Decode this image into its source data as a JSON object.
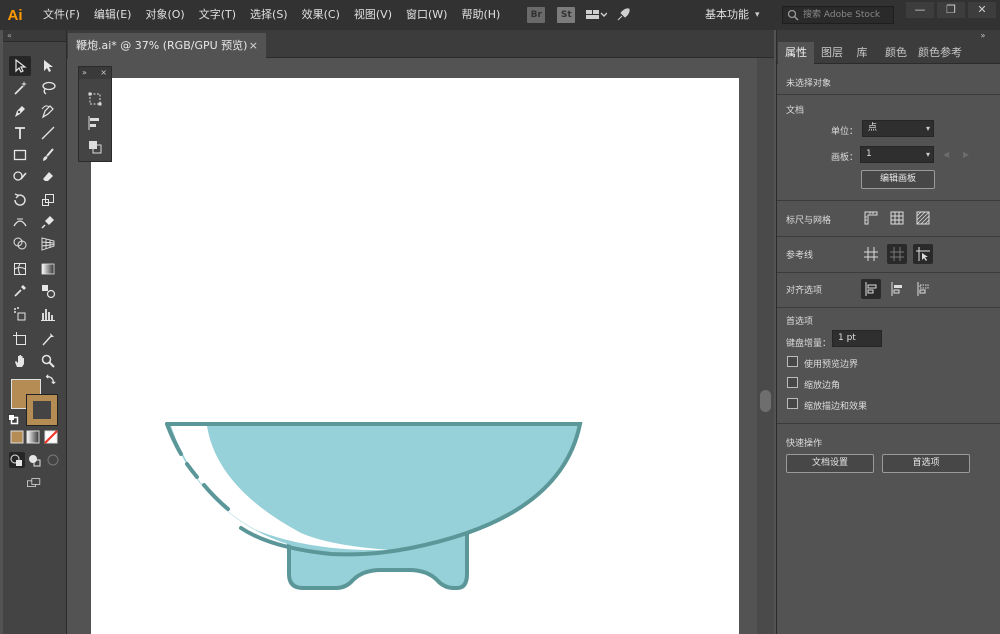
{
  "app": {
    "logo": "Ai",
    "menus": [
      "文件(F)",
      "编辑(E)",
      "对象(O)",
      "文字(T)",
      "选择(S)",
      "效果(C)",
      "视图(V)",
      "窗口(W)",
      "帮助(H)"
    ],
    "bridge_label": "Br",
    "stock_label": "St",
    "workspace": "基本功能",
    "search_placeholder": "搜索 Adobe Stock",
    "window_buttons": [
      "—",
      "❐",
      "✕"
    ]
  },
  "document": {
    "tab_title": "鞭炮.ai* @ 37% (RGB/GPU 预览)",
    "close": "×"
  },
  "colors": {
    "fill": "#b68c55",
    "stroke": "#b68c55",
    "bowl_fill": "#96d0d8",
    "bowl_stroke": "#5b9698",
    "accent_app": "#ff9a00"
  },
  "panel": {
    "tabs": [
      "属性",
      "图层",
      "库",
      "颜色",
      "颜色参考"
    ],
    "no_selection": "未选择对象",
    "document_section": "文档",
    "unit_label": "单位：",
    "unit_value": "点",
    "artboard_label": "画板：",
    "artboard_value": "1",
    "edit_artboard_button": "编辑画板",
    "rulers_grids_label": "标尺与网格",
    "guides_label": "参考线",
    "align_options_label": "对齐选项",
    "preferences_section": "首选项",
    "keyboard_increment_label": "键盘增量：",
    "keyboard_increment_value": "1 pt",
    "checkboxes": [
      "使用预览边界",
      "缩放边角",
      "缩放描边和效果"
    ],
    "quick_actions_section": "快速操作",
    "doc_setup_button": "文档设置",
    "preferences_button": "首选项"
  },
  "icons": {
    "toolbar": [
      "selection-tool-icon",
      "direct-selection-tool-icon",
      "magic-wand-icon",
      "lasso-icon",
      "pen-icon",
      "curvature-icon",
      "type-icon",
      "line-icon",
      "rectangle-icon",
      "paintbrush-icon",
      "shaper-icon",
      "eraser-icon",
      "rotate-icon",
      "scale-icon",
      "width-icon",
      "puppet-warp-icon",
      "shape-builder-icon",
      "perspective-grid-icon",
      "mesh-icon",
      "gradient-icon",
      "eyedropper-icon",
      "blend-icon",
      "symbol-sprayer-icon",
      "column-graph-icon",
      "artboard-icon",
      "slice-icon",
      "hand-icon",
      "zoom-icon"
    ]
  }
}
